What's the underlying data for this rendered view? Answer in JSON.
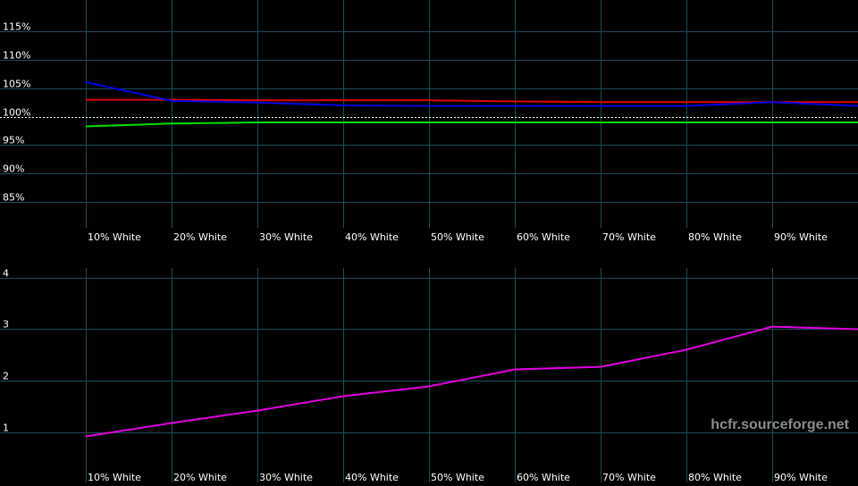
{
  "watermark": "hcfr.sourceforge.net",
  "colors": {
    "background": "#000000",
    "grid": "#1e4b5a",
    "reference": "#ffffff",
    "red": "#e00000",
    "green": "#00e000",
    "blue": "#0000e0",
    "magenta": "#e000e0"
  },
  "chart_data": [
    {
      "type": "line",
      "title": "",
      "xlabel": "",
      "ylabel": "",
      "categories": [
        "10% White",
        "20% White",
        "30% White",
        "40% White",
        "50% White",
        "60% White",
        "70% White",
        "80% White",
        "90% White"
      ],
      "y_tick_labels": [
        "115%",
        "110%",
        "105%",
        "100%",
        "95%",
        "90%",
        "85%"
      ],
      "y_ticks": [
        115,
        110,
        105,
        100,
        95,
        90,
        85
      ],
      "ylim": [
        82,
        119
      ],
      "reference_line": 100,
      "grid": true,
      "series": [
        {
          "color": "red",
          "values": [
            103.0,
            103.0,
            102.9,
            102.9,
            102.9,
            102.7,
            102.6,
            102.6,
            102.6,
            102.6
          ]
        },
        {
          "color": "green",
          "values": [
            98.3,
            98.8,
            99.0,
            99.0,
            99.0,
            99.0,
            99.0,
            99.0,
            99.0,
            99.0
          ]
        },
        {
          "color": "blue",
          "values": [
            106.1,
            102.8,
            102.5,
            102.0,
            101.9,
            101.9,
            101.9,
            101.9,
            102.6,
            101.9
          ]
        }
      ]
    },
    {
      "type": "line",
      "title": "",
      "xlabel": "",
      "ylabel": "",
      "categories": [
        "10% White",
        "20% White",
        "30% White",
        "40% White",
        "50% White",
        "60% White",
        "70% White",
        "80% White",
        "90% White"
      ],
      "y_tick_labels": [
        "4",
        "3",
        "2",
        "1"
      ],
      "y_ticks": [
        4,
        3,
        2,
        1
      ],
      "ylim": [
        0.2,
        4.1
      ],
      "grid": true,
      "series": [
        {
          "color": "magenta",
          "values": [
            0.92,
            1.18,
            1.42,
            1.7,
            1.89,
            2.22,
            2.27,
            2.6,
            3.05,
            3.0
          ]
        }
      ]
    }
  ]
}
